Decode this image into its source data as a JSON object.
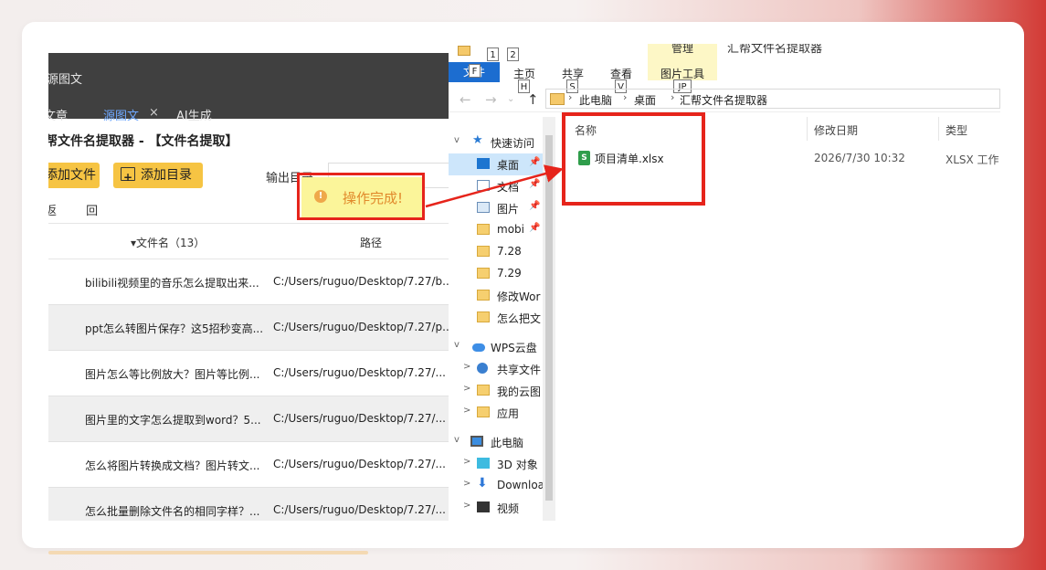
{
  "left_app": {
    "top_text": "源图文",
    "tabs": [
      {
        "label": "文章"
      },
      {
        "label": "源图文",
        "close": "×"
      },
      {
        "label": "AI生成"
      }
    ],
    "title": "帮文件名提取器 - 【文件名提取】",
    "add_file_label": "添加文件",
    "add_dir_label": "添加目录",
    "output_label": "输出目录",
    "nav_text": "返 回",
    "table": {
      "col_name": "▾文件名（13）",
      "col_path": "路径",
      "rows": [
        {
          "name": "bilibili视频里的音乐怎么提取出来...",
          "path": "C:/Users/ruguo/Desktop/7.27/b..."
        },
        {
          "name": "ppt怎么转图片保存？这5招秒变高...",
          "path": "C:/Users/ruguo/Desktop/7.27/p..."
        },
        {
          "name": "图片怎么等比例放大？图片等比例...",
          "path": "C:/Users/ruguo/Desktop/7.27/..."
        },
        {
          "name": "图片里的文字怎么提取到word？5...",
          "path": "C:/Users/ruguo/Desktop/7.27/..."
        },
        {
          "name": "怎么将图片转换成文档？图片转文...",
          "path": "C:/Users/ruguo/Desktop/7.27/..."
        },
        {
          "name": "怎么批量删除文件名的相同字样？...",
          "path": "C:/Users/ruguo/Desktop/7.27/..."
        }
      ]
    }
  },
  "toast": {
    "icon": "!",
    "message": "操作完成!"
  },
  "explorer": {
    "window_title": "汇帮文件名提取器",
    "file_tab": "文件",
    "ribbon_tabs": [
      "主页",
      "共享",
      "查看"
    ],
    "manage_label": "管理",
    "picture_tools": "图片工具",
    "keytips": {
      "file": "F",
      "qat1": "1",
      "qat2": "2",
      "home": "H",
      "share": "S",
      "view": "V",
      "pic": "JP"
    },
    "breadcrumb": [
      "此电脑",
      "桌面",
      "汇帮文件名提取器"
    ],
    "tree": [
      {
        "label": "快速访问",
        "icon": "star-icon",
        "chev": "v"
      },
      {
        "label": "桌面",
        "icon": "desktop-icon",
        "pin": true,
        "selected": true
      },
      {
        "label": "文档",
        "icon": "document-icon",
        "pin": true
      },
      {
        "label": "图片",
        "icon": "picture-icon",
        "pin": true
      },
      {
        "label": "mobi",
        "icon": "folder-icon",
        "pin": true
      },
      {
        "label": "7.28",
        "icon": "folder-icon"
      },
      {
        "label": "7.29",
        "icon": "folder-icon"
      },
      {
        "label": "修改Wor",
        "icon": "folder-icon"
      },
      {
        "label": "怎么把文",
        "icon": "folder-icon"
      },
      {
        "label": "WPS云盘",
        "icon": "cloud-icon",
        "chev": "v"
      },
      {
        "label": "共享文件",
        "icon": "share-icon",
        "chev": ">"
      },
      {
        "label": "我的云图",
        "icon": "folder-icon",
        "chev": ">"
      },
      {
        "label": "应用",
        "icon": "folder-icon",
        "chev": ">"
      },
      {
        "label": "此电脑",
        "icon": "pc-icon",
        "chev": "v"
      },
      {
        "label": "3D 对象",
        "icon": "cube-icon",
        "chev": ">"
      },
      {
        "label": "Downloa",
        "icon": "download-icon",
        "chev": ">"
      },
      {
        "label": "视频",
        "icon": "video-icon",
        "chev": ">"
      }
    ],
    "columns": {
      "name": "名称",
      "date": "修改日期",
      "type": "类型"
    },
    "files": [
      {
        "name": "项目清单.xlsx",
        "date": "2026/7/30 10:32",
        "type": "XLSX 工作",
        "icon_letter": "S"
      }
    ]
  },
  "colors": {
    "accent_red": "#e6241b",
    "button_yellow": "#f6c443",
    "toast_yellow": "#fbf59a",
    "explorer_blue": "#1c6dd0"
  }
}
